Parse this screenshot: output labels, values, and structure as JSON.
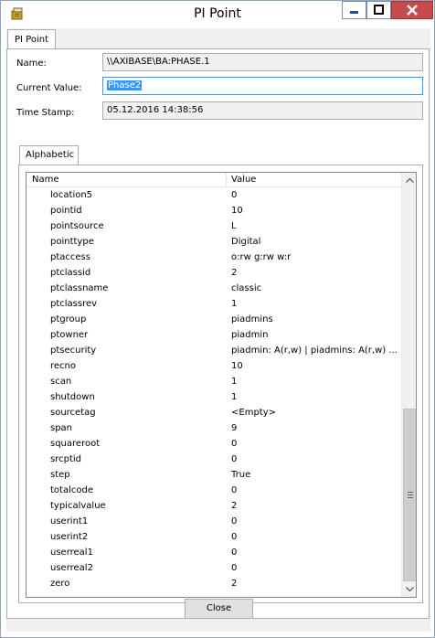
{
  "window": {
    "title": "PI Point",
    "controls": [
      "minimize",
      "maximize",
      "close"
    ]
  },
  "tabs": [
    {
      "label": "PI Point",
      "selected": true
    }
  ],
  "fields": {
    "name_label": "Name:",
    "name_value": "\\\\AXIBASE\\BA:PHASE.1",
    "current_value_label": "Current Value:",
    "current_value": "Phase2",
    "timestamp_label": "Time Stamp:",
    "timestamp_value": "05.12.2016 14:38:56"
  },
  "subtabs": [
    {
      "label": "Alphabetic",
      "selected": true
    }
  ],
  "grid": {
    "columns": [
      "Name",
      "Value"
    ],
    "rows": [
      {
        "name": "location5",
        "value": "0"
      },
      {
        "name": "pointid",
        "value": "10"
      },
      {
        "name": "pointsource",
        "value": "L"
      },
      {
        "name": "pointtype",
        "value": "Digital"
      },
      {
        "name": "ptaccess",
        "value": "o:rw g:rw w:r"
      },
      {
        "name": "ptclassid",
        "value": "2"
      },
      {
        "name": "ptclassname",
        "value": "classic"
      },
      {
        "name": "ptclassrev",
        "value": "1"
      },
      {
        "name": "ptgroup",
        "value": "piadmins"
      },
      {
        "name": "ptowner",
        "value": "piadmin"
      },
      {
        "name": "ptsecurity",
        "value": "piadmin: A(r,w) | piadmins: A(r,w) ..."
      },
      {
        "name": "recno",
        "value": "10"
      },
      {
        "name": "scan",
        "value": "1"
      },
      {
        "name": "shutdown",
        "value": "1"
      },
      {
        "name": "sourcetag",
        "value": "<Empty>"
      },
      {
        "name": "span",
        "value": "9"
      },
      {
        "name": "squareroot",
        "value": "0"
      },
      {
        "name": "srcptid",
        "value": "0"
      },
      {
        "name": "step",
        "value": "True"
      },
      {
        "name": "totalcode",
        "value": "0"
      },
      {
        "name": "typicalvalue",
        "value": "2"
      },
      {
        "name": "userint1",
        "value": "0"
      },
      {
        "name": "userint2",
        "value": "0"
      },
      {
        "name": "userreal1",
        "value": "0"
      },
      {
        "name": "userreal2",
        "value": "0"
      },
      {
        "name": "zero",
        "value": "2"
      }
    ]
  },
  "buttons": {
    "close_label": "Close"
  },
  "colors": {
    "close_button_bg": "#c74b4b",
    "selection": "#3399ff",
    "border": "#8aa6c4"
  }
}
